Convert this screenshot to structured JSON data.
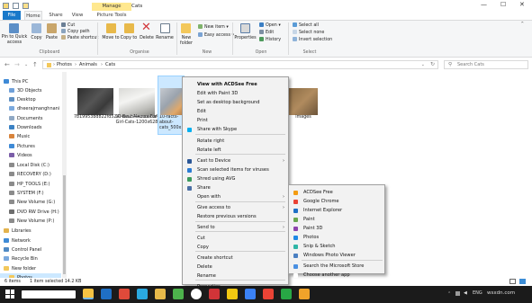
{
  "window": {
    "manage_tab": "Manage",
    "title": "Cats",
    "controls": {
      "minimize": "—",
      "maximize": "☐",
      "close": "✕"
    }
  },
  "ribbon": {
    "tabs": [
      "File",
      "Home",
      "Share",
      "View",
      "Picture Tools"
    ],
    "clipboard": {
      "pin": "Pin to Quick access",
      "copy": "Copy",
      "paste": "Paste",
      "cut": "Cut",
      "copy_path": "Copy path",
      "paste_shortcut": "Paste shortcut",
      "label": "Clipboard"
    },
    "organise": {
      "move_to": "Move to",
      "copy_to": "Copy to",
      "delete": "Delete",
      "rename": "Rename",
      "label": "Organise"
    },
    "new": {
      "new_folder": "New folder",
      "new_item": "New item",
      "easy_access": "Easy access",
      "label": "New"
    },
    "open": {
      "properties": "Properties",
      "open": "Open",
      "edit": "Edit",
      "history": "History",
      "label": "Open"
    },
    "select": {
      "select_all": "Select all",
      "select_none": "Select none",
      "invert": "Invert selection",
      "label": "Select"
    }
  },
  "address": {
    "path": [
      "Photos",
      "Animals",
      "Cats"
    ],
    "search_placeholder": "Search Cats"
  },
  "nav": {
    "items": [
      "This PC",
      "3D Objects",
      "Desktop",
      "dheerajmanghnani",
      "Documents",
      "Downloads",
      "Music",
      "Pictures",
      "Videos",
      "Local Disk (C:)",
      "RECOVERY (D:)",
      "HP_TOOLS (E:)",
      "SYSTEM (F:)",
      "New Volume (G:)",
      "DVD RW Drive (H:)",
      "New Volume (P:)",
      "Libraries",
      "Network",
      "Control Panel",
      "Recycle Bin",
      "New folder",
      "Photos"
    ]
  },
  "files": [
    {
      "name": "7b19953bd822fd5247fea25442c8b8af"
    },
    {
      "name": "10-Best-Names-For-Girl-Cats-1200x628"
    },
    {
      "name": "10-facts-about-cats_500x"
    },
    {
      "name": "images"
    }
  ],
  "status": {
    "count": "6 items",
    "selection": "1 item selected  14.2 KB"
  },
  "context_menu": {
    "items": [
      "View with ACDSee Free",
      "Edit with Paint 3D",
      "Set as desktop background",
      "Edit",
      "Print",
      "Share with Skype",
      "Rotate right",
      "Rotate left",
      "Cast to Device",
      "Scan selected items for viruses",
      "Shred using AVG",
      "Share",
      "Open with",
      "Give access to",
      "Restore previous versions",
      "Send to",
      "Cut",
      "Copy",
      "Create shortcut",
      "Delete",
      "Rename",
      "Properties"
    ]
  },
  "open_with_menu": {
    "items": [
      "ACDSee Free",
      "Google Chrome",
      "Internet Explorer",
      "Paint",
      "Paint 3D",
      "Photos",
      "Snip & Sketch",
      "Windows Photo Viewer",
      "Search the Microsoft Store",
      "Choose another app"
    ]
  },
  "taskbar": {
    "tray_text": "ENG",
    "time": "wsxdn.com"
  },
  "colors": {
    "accent": "#1979ca",
    "manage": "#ffe88f",
    "taskbar": "#1b1b1b"
  }
}
